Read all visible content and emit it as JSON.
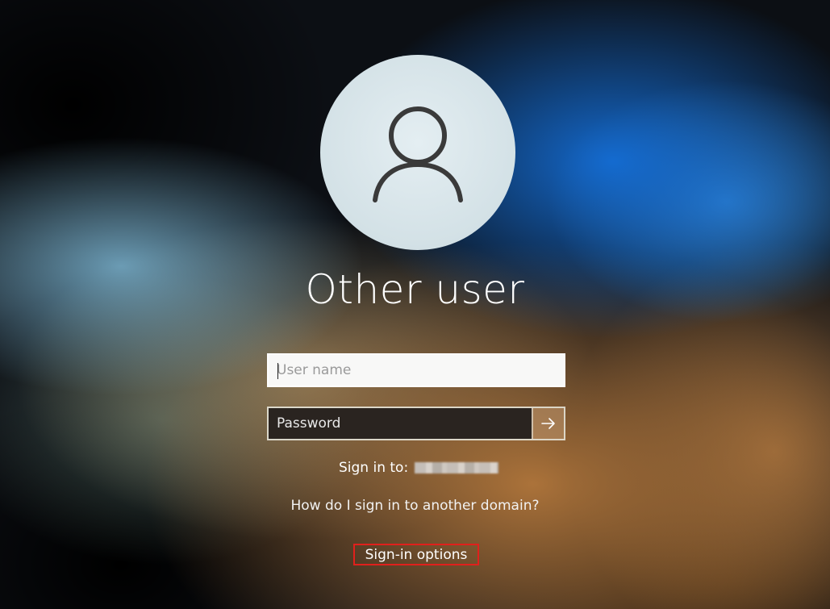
{
  "user": {
    "display_name": "Other user",
    "avatar_icon": "person-icon"
  },
  "form": {
    "username_placeholder": "User name",
    "password_placeholder": "Password",
    "submit_icon": "arrow-right-icon"
  },
  "signin_to": {
    "label": "Sign in to:"
  },
  "links": {
    "help": "How do I sign in to another domain?",
    "signin_options": "Sign-in options"
  },
  "colors": {
    "highlight_border": "#e0201c",
    "password_bg": "#2a2420"
  }
}
